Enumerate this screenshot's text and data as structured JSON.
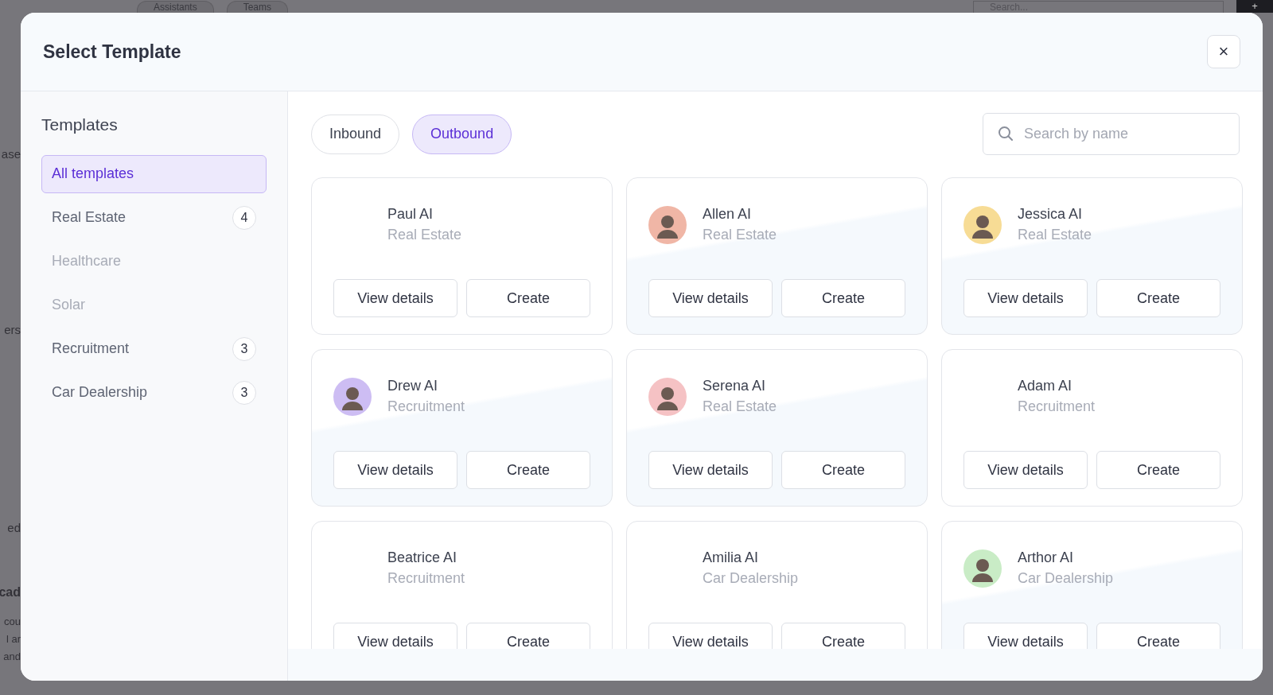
{
  "backdrop": {
    "tabs": [
      "Assistants",
      "Teams"
    ],
    "search": {
      "placeholder": "Search..."
    },
    "add_button": "+",
    "side_fragments": [
      {
        "text": "ase",
        "kind": "label"
      },
      {
        "text": "ers",
        "kind": "label"
      },
      {
        "text": "ed",
        "kind": "label"
      },
      {
        "text": "cad",
        "kind": "heading"
      },
      {
        "text": "cou",
        "kind": "line"
      },
      {
        "text": "l ar",
        "kind": "line"
      },
      {
        "text": "and",
        "kind": "line"
      }
    ]
  },
  "dialog": {
    "title": "Select Template",
    "close": "×"
  },
  "sidebar": {
    "title": "Templates",
    "items": [
      {
        "label": "All templates",
        "selected": true,
        "disabled": false
      },
      {
        "label": "Real Estate",
        "count": "4",
        "selected": false,
        "disabled": false
      },
      {
        "label": "Healthcare",
        "selected": false,
        "disabled": true
      },
      {
        "label": "Solar",
        "selected": false,
        "disabled": true
      },
      {
        "label": "Recruitment",
        "count": "3",
        "selected": false,
        "disabled": false
      },
      {
        "label": "Car Dealership",
        "count": "3",
        "selected": false,
        "disabled": false
      }
    ]
  },
  "tabs": [
    {
      "label": "Inbound",
      "selected": false
    },
    {
      "label": "Outbound",
      "selected": true
    }
  ],
  "search": {
    "placeholder": "Search by name"
  },
  "cards": [
    {
      "name": "Paul AI",
      "category": "Real Estate",
      "buttons": [
        "View details",
        "Create"
      ]
    },
    {
      "name": "Allen AI",
      "category": "Real Estate",
      "color": "#f0b6a6",
      "buttons": [
        "View details",
        "Create"
      ]
    },
    {
      "name": "Jessica AI",
      "category": "Real Estate",
      "color": "#f7dc95",
      "buttons": [
        "View details",
        "Create"
      ]
    },
    {
      "name": "Drew AI",
      "category": "Recruitment",
      "color": "#cdbdf3",
      "buttons": [
        "View details",
        "Create"
      ]
    },
    {
      "name": "Serena AI",
      "category": "Real Estate",
      "color": "#f5c2c4",
      "buttons": [
        "View details",
        "Create"
      ]
    },
    {
      "name": "Adam AI",
      "category": "Recruitment",
      "buttons": [
        "View details",
        "Create"
      ]
    },
    {
      "name": "Beatrice AI",
      "category": "Recruitment",
      "buttons": [
        "View details",
        "Create"
      ]
    },
    {
      "name": "Amilia AI",
      "category": "Car Dealership",
      "buttons": [
        "View details",
        "Create"
      ]
    },
    {
      "name": "Arthor AI",
      "category": "Car Dealership",
      "color": "#c9ecc6",
      "buttons": [
        "View details",
        "Create"
      ]
    }
  ]
}
